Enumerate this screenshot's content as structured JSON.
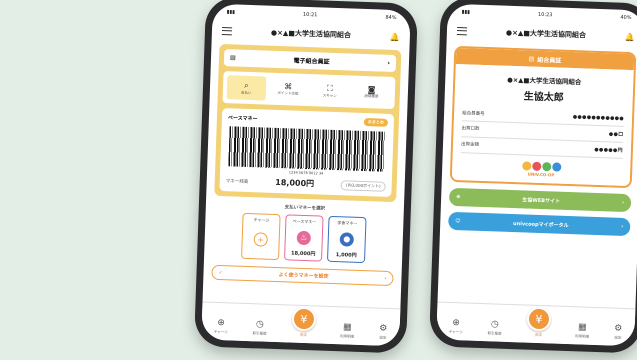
{
  "phone1": {
    "status": {
      "time": "10:21",
      "battery": "84%"
    },
    "header": {
      "title": "●×▲■大学生活協同組合"
    },
    "member_card_button": "電子組合員証",
    "icons": [
      {
        "label": "支払い",
        "glyph": "🔍",
        "icon": "search-pay-icon"
      },
      {
        "label": "ポイント交換",
        "glyph": "⌘",
        "icon": "qr-exchange-icon"
      },
      {
        "label": "スキャン",
        "glyph": "⛶",
        "icon": "scan-icon"
      },
      {
        "label": "読取履歴",
        "glyph": "📷",
        "icon": "camera-icon"
      }
    ],
    "pay_card": {
      "title": "ベースマネー",
      "tag": "おまとめ",
      "barcode_number": "1234 5678 9012 34",
      "balance_label": "マネー残高",
      "balance": "18,000円",
      "points": "(内3,000ポイント)"
    },
    "money_select_title": "支払いマネーを選択",
    "money_cards": [
      {
        "name": "チャージ",
        "glyph": "+",
        "amount": "",
        "cls": "charge"
      },
      {
        "name": "ベースマネー",
        "glyph": "♨",
        "amount": "18,000円",
        "cls": "base"
      },
      {
        "name": "学食マネー",
        "glyph": "●",
        "amount": "1,000円",
        "cls": "gak"
      }
    ],
    "set_button": "よく使うマネーを設定",
    "tabs": [
      {
        "label": "チャージ",
        "glyph": "⊕"
      },
      {
        "label": "取引履歴",
        "glyph": "◷"
      },
      {
        "label": "決済",
        "glyph": "¥"
      },
      {
        "label": "利用明細",
        "glyph": "▦"
      },
      {
        "label": "設定",
        "glyph": "⚙"
      }
    ]
  },
  "phone2": {
    "status": {
      "time": "10:23",
      "battery": "40%"
    },
    "header": {
      "title": "●×▲■大学生活協同組合"
    },
    "card_header": "組合員証",
    "org": "●×▲■大学生活協同組合",
    "name": "生協太郎",
    "rows": [
      {
        "label": "組合員番号",
        "value": "●●●●●●●●●●●"
      },
      {
        "label": "出資口数",
        "value": "●●口"
      },
      {
        "label": "出資金額",
        "value": "●●●●●円"
      }
    ],
    "logo_text": "UNIV.CO-OP",
    "logo_colors": [
      "#f4b73b",
      "#e5555a",
      "#5bb35a",
      "#3a8fd6"
    ],
    "links": [
      {
        "label": "生協WEBサイト",
        "icon": "globe-icon",
        "glyph": "⊕"
      },
      {
        "label": "univcoopマイポータル",
        "icon": "person-icon",
        "glyph": "☺"
      }
    ],
    "tabs": [
      {
        "label": "チャージ",
        "glyph": "⊕"
      },
      {
        "label": "取引履歴",
        "glyph": "◷"
      },
      {
        "label": "決済",
        "glyph": "¥"
      },
      {
        "label": "利用明細",
        "glyph": "▦"
      },
      {
        "label": "設定",
        "glyph": "⚙"
      }
    ]
  }
}
